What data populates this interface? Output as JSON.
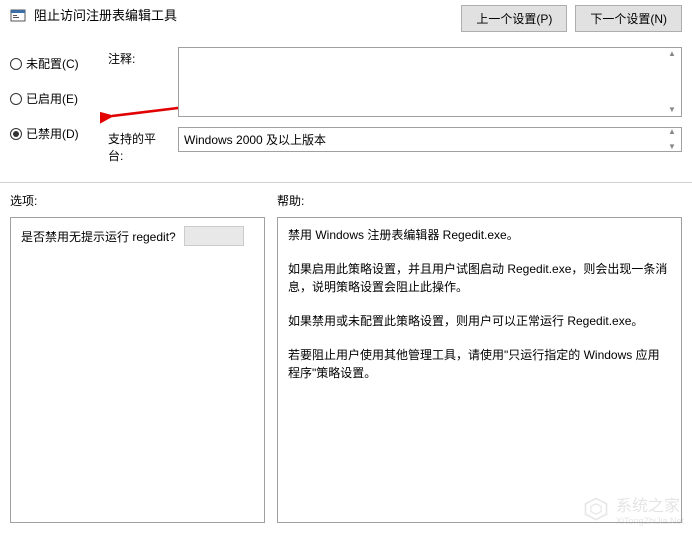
{
  "header": {
    "title": "阻止访问注册表编辑工具",
    "prev_btn": "上一个设置(P)",
    "next_btn": "下一个设置(N)"
  },
  "radios": {
    "not_configured": "未配置(C)",
    "enabled": "已启用(E)",
    "disabled": "已禁用(D)"
  },
  "fields": {
    "comment_label": "注释:",
    "comment_value": "",
    "platform_label": "支持的平台:",
    "platform_value": "Windows 2000 及以上版本"
  },
  "sections": {
    "options_label": "选项:",
    "help_label": "帮助:"
  },
  "options": {
    "question": "是否禁用无提示运行 regedit?"
  },
  "help": {
    "p1": "禁用 Windows 注册表编辑器 Regedit.exe。",
    "p2": "如果启用此策略设置，并且用户试图启动 Regedit.exe，则会出现一条消息，说明策略设置会阻止此操作。",
    "p3": "如果禁用或未配置此策略设置，则用户可以正常运行 Regedit.exe。",
    "p4": "若要阻止用户使用其他管理工具，请使用\"只运行指定的 Windows 应用程序\"策略设置。"
  },
  "watermark": {
    "text": "系统之家",
    "sub": "XiTongZhiJia.Net"
  }
}
